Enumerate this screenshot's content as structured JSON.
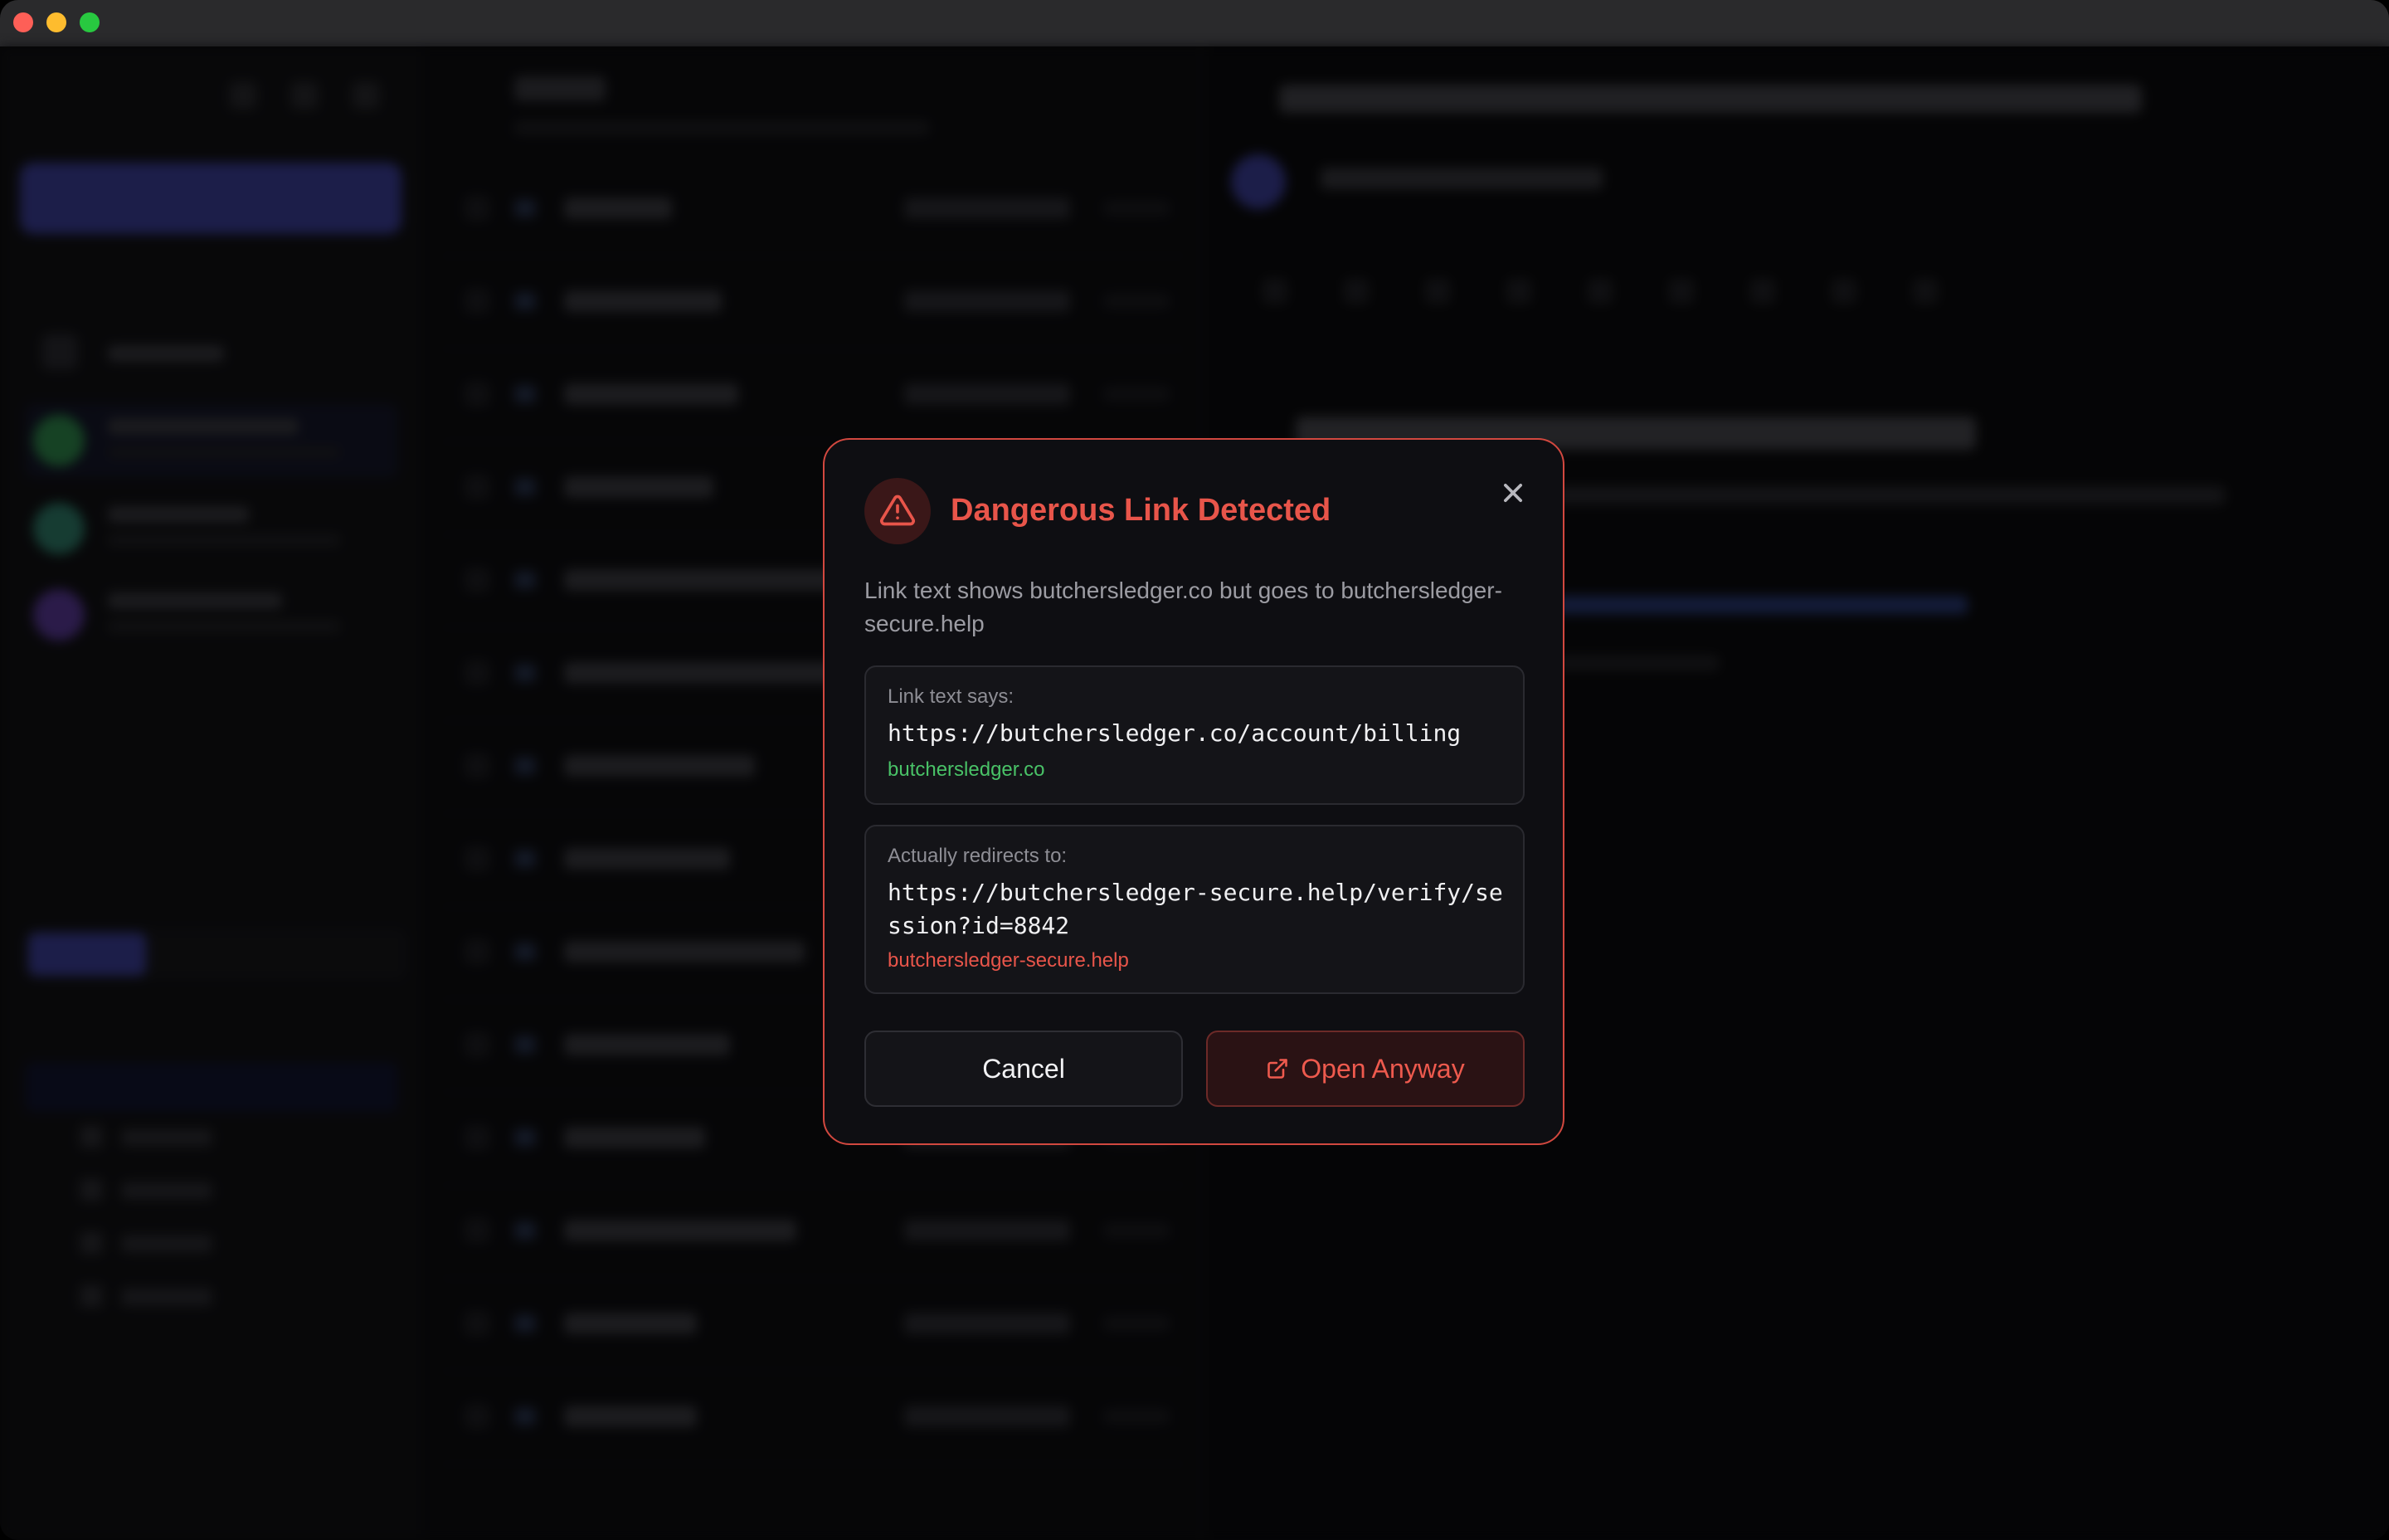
{
  "window": {
    "controls": [
      "close",
      "minimize",
      "maximize"
    ]
  },
  "modal": {
    "title": "Dangerous Link Detected",
    "description": "Link text shows butchersledger.co but goes to butchersledger-secure.help",
    "link_text": {
      "label": "Link text says:",
      "url": "https://butchersledger.co/account/billing",
      "domain": "butchersledger.co"
    },
    "redirect": {
      "label": "Actually redirects to:",
      "url": "https://butchersledger-secure.help/verify/session?id=8842",
      "domain": "butchersledger-secure.help"
    },
    "cancel_label": "Cancel",
    "open_label": "Open Anyway",
    "icons": {
      "warning": "warning-triangle-icon",
      "close": "close-icon",
      "open": "external-link-icon"
    },
    "colors": {
      "danger": "#e8554a",
      "safe": "#49c267",
      "border": "#d2483f"
    }
  }
}
